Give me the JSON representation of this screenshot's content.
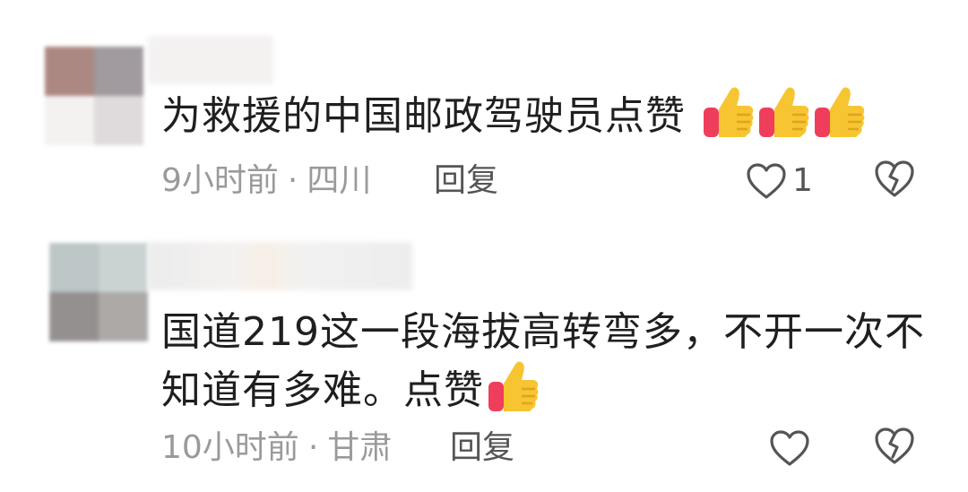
{
  "comments": [
    {
      "text": "为救援的中国邮政驾驶员点赞",
      "emoji_count": 3,
      "time": "9小时前",
      "separator": "·",
      "location": "四川",
      "reply_label": "回复",
      "like_count": "1",
      "emoji_icon": "thumbs-up-emoji",
      "like_icon": "heart-outline-icon",
      "dislike_icon": "broken-heart-icon"
    },
    {
      "text_line1": "国道219这一段海拔高转弯多，不开一次不",
      "text_line2": "知道有多难。点赞",
      "emoji_count": 1,
      "time": "10小时前",
      "separator": "·",
      "location": "甘肃",
      "reply_label": "回复",
      "like_count": "",
      "emoji_icon": "thumbs-up-emoji",
      "like_icon": "heart-outline-icon",
      "dislike_icon": "broken-heart-icon"
    }
  ],
  "colors": {
    "body_text": "#1f1f1f",
    "meta_text": "#9a9a9a",
    "action_text": "#555555",
    "icon_stroke": "#555555",
    "thumb_yellow": "#f7c531",
    "thumb_cuff": "#ef3e5c"
  }
}
